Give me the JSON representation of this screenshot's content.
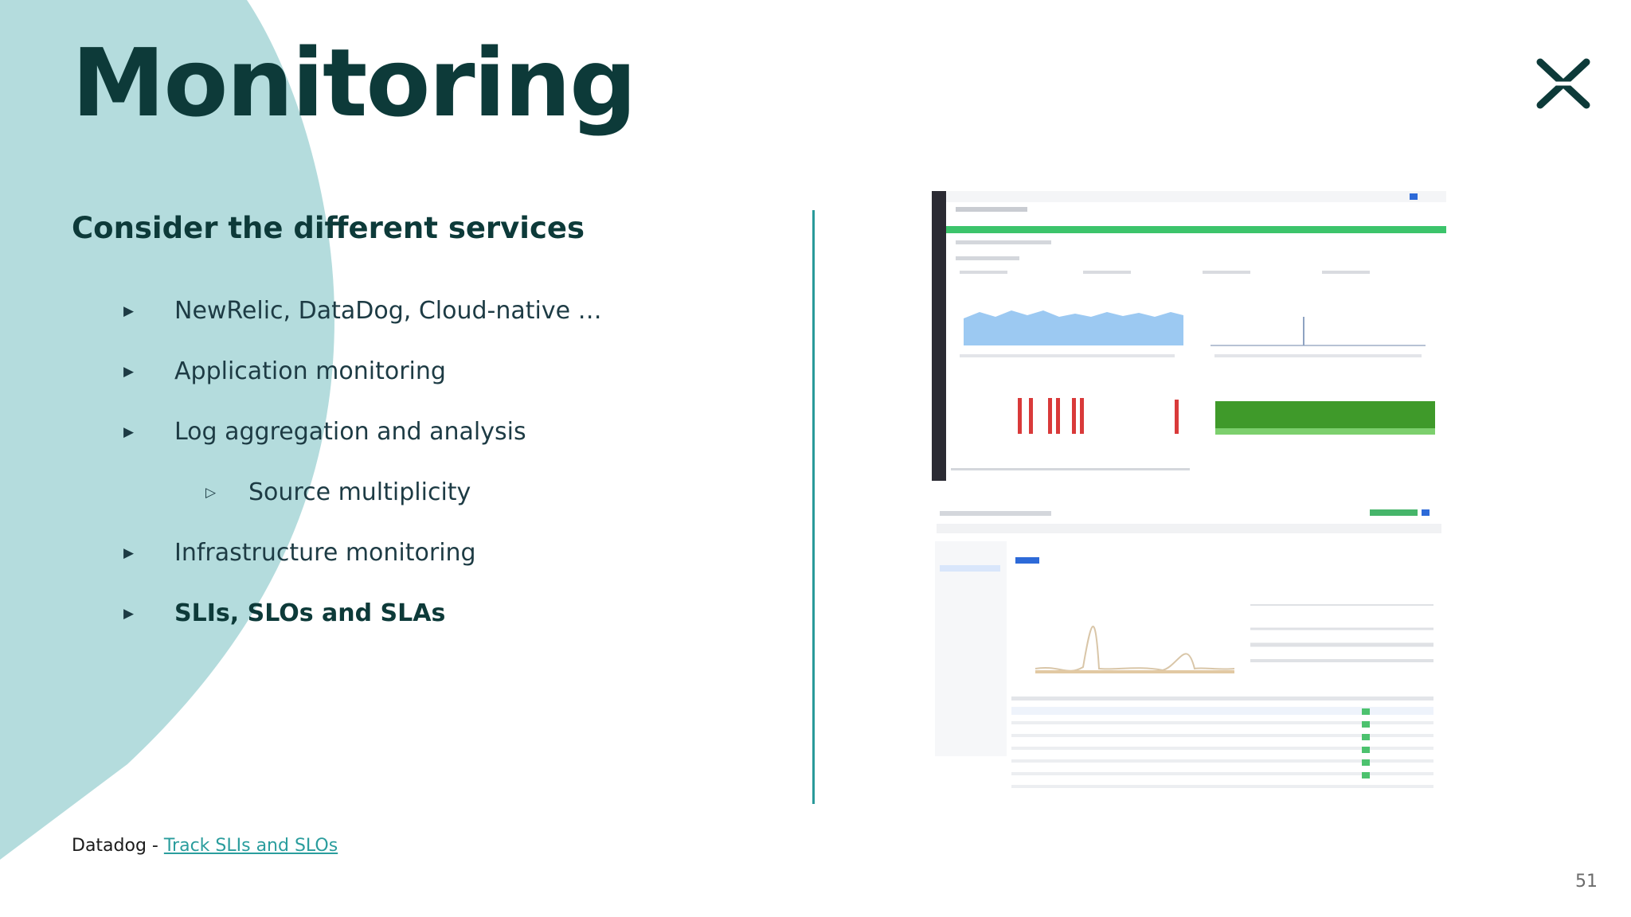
{
  "slide": {
    "title": "Monitoring",
    "subtitle": "Consider the different services",
    "bullets": [
      {
        "text": "NewRelic, DataDog, Cloud-native …",
        "level": 1,
        "bold": false
      },
      {
        "text": "Application monitoring",
        "level": 1,
        "bold": false
      },
      {
        "text": "Log aggregation and analysis",
        "level": 1,
        "bold": false
      },
      {
        "text": "Source multiplicity",
        "level": 2,
        "bold": false
      },
      {
        "text": "Infrastructure monitoring",
        "level": 1,
        "bold": false
      },
      {
        "text": "SLIs, SLOs and SLAs",
        "level": 1,
        "bold": true
      }
    ],
    "source_prefix": "Datadog - ",
    "source_link": "Track SLIs and SLOs",
    "page_number": "51"
  },
  "colors": {
    "title": "#0d3a39",
    "accent_teal": "#2a9a9a",
    "blob": "#b4dcdd",
    "link": "#2a9d9d"
  },
  "icons": {
    "logo": "x-logo-icon",
    "bullet_level1": "filled-triangle-right-icon",
    "bullet_level2": "outline-triangle-right-icon"
  }
}
